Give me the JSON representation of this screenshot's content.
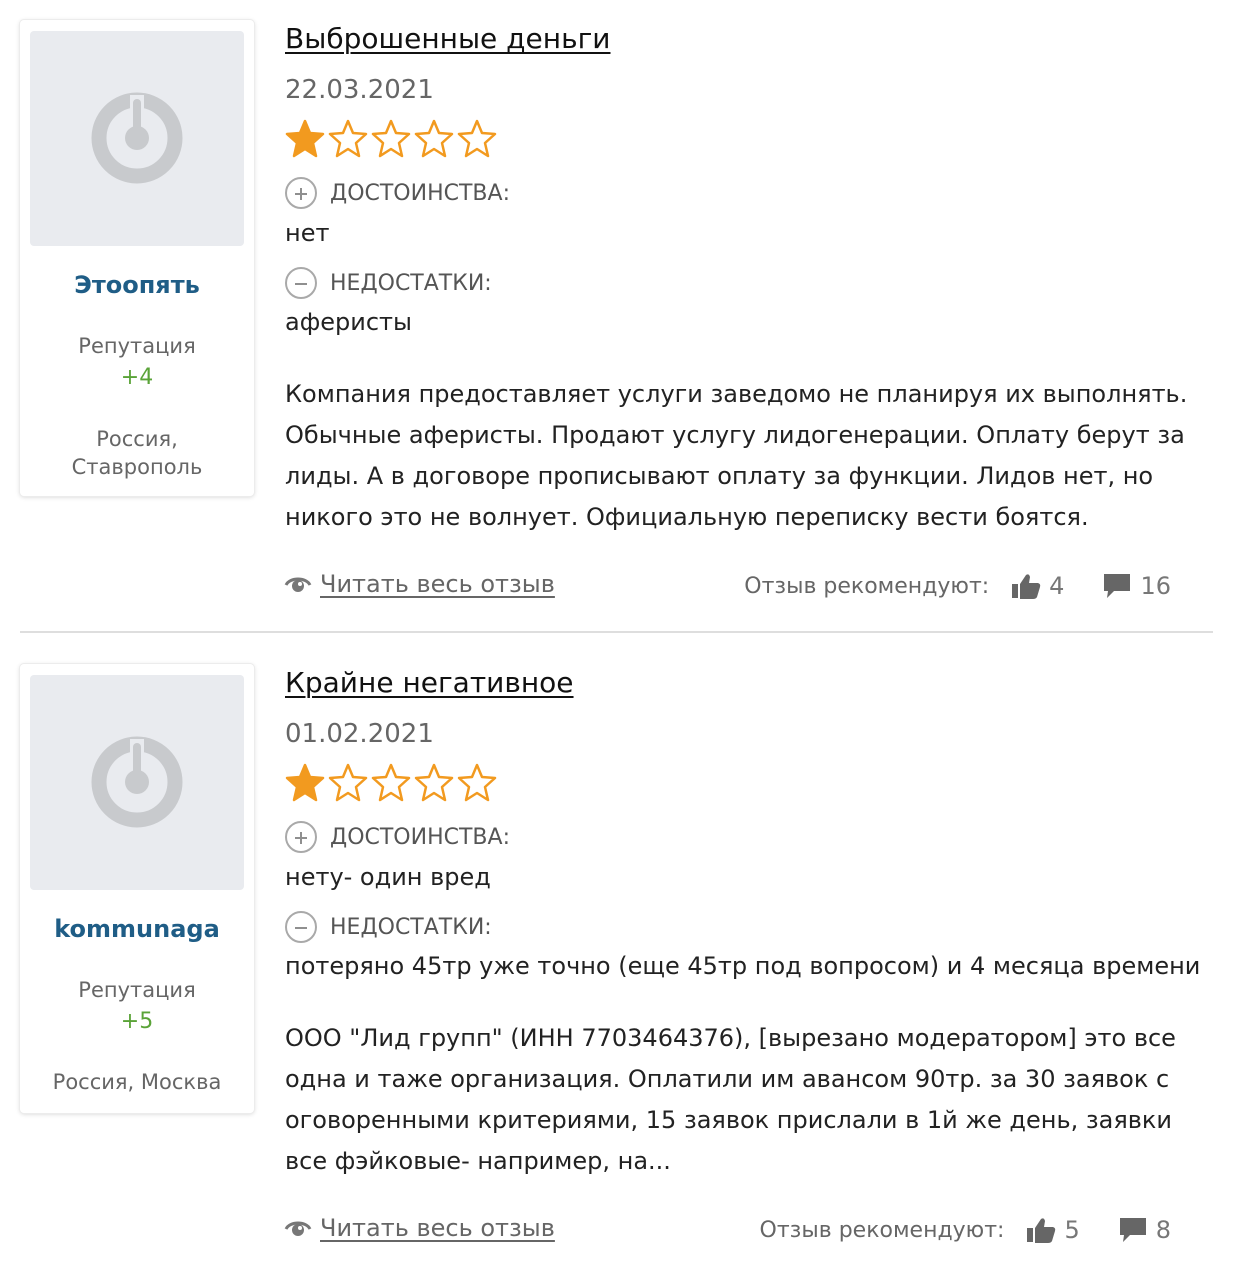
{
  "reviews": [
    {
      "title": "Выброшенные деньги",
      "date": "22.03.2021",
      "rating": 1,
      "rating_max": 5,
      "author": {
        "name": "Этоопять",
        "reputation_label": "Репутация",
        "reputation": "+4",
        "location": "Россия, Ставрополь"
      },
      "pros_label": "ДОСТОИНСТВА:",
      "pros": "нет",
      "cons_label": "НЕДОСТАТКИ:",
      "cons": "аферисты",
      "text": "Компания предоставляет услуги заведомо не планируя их выполнять. Обычные аферисты. Продают услугу лидогенерации. Оплату берут за лиды. А в договоре прописывают оплату за функции. Лидов нет, но никого это не волнует. Официальную переписку вести боятся.",
      "read_more": "Читать весь отзыв",
      "recommend_label": "Отзыв рекомендуют:",
      "likes": "4",
      "comments": "16"
    },
    {
      "title": "Крайне негативное",
      "date": "01.02.2021",
      "rating": 1,
      "rating_max": 5,
      "author": {
        "name": "kommunaga",
        "reputation_label": "Репутация",
        "reputation": "+5",
        "location": "Россия, Москва"
      },
      "pros_label": "ДОСТОИНСТВА:",
      "pros": "нету- один вред",
      "cons_label": "НЕДОСТАТКИ:",
      "cons": "потеряно 45тр уже точно (еще 45тр под вопросом) и 4 месяца времени",
      "text": "ООО \"Лид групп\" (ИНН 7703464376), [вырезано модератором] это все одна и таже организация. Оплатили им авансом 90тр. за 30 заявок с оговоренными критериями, 15 заявок прислали в 1й же день, заявки все фэйковые- например, на...",
      "read_more": "Читать весь отзыв",
      "recommend_label": "Отзыв рекомендуют:",
      "likes": "5",
      "comments": "8"
    }
  ],
  "colors": {
    "username": "#1f5d86",
    "reputation": "#5aa338",
    "star": "#f29a1f"
  }
}
